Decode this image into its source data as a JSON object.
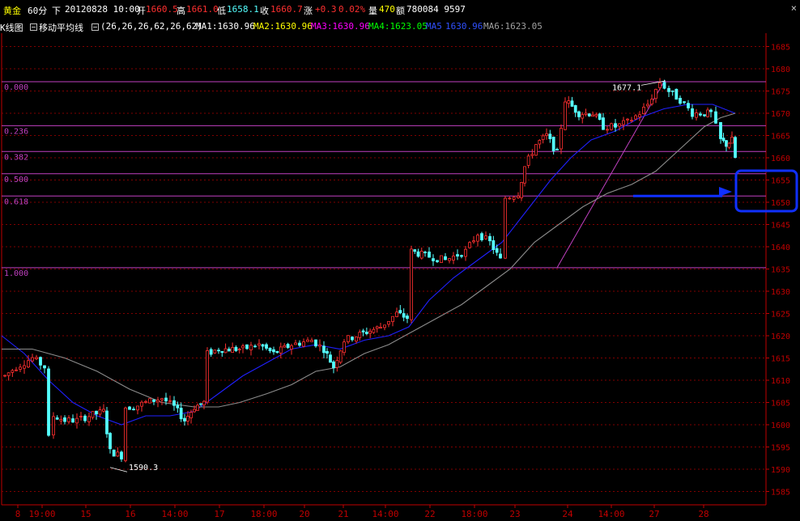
{
  "header": {
    "symbol": "黄金",
    "period": "60分",
    "direction": "下",
    "datetime": "20120828 10:00",
    "open_label": "开",
    "open": "1660.5",
    "high_label": "高",
    "high": "1661.0",
    "low_label": "低",
    "low": "1658.1",
    "close_label": "收",
    "close": "1660.7",
    "change_label": "涨",
    "change": "+0.3",
    "change_pct": "0.02%",
    "volume_label": "量",
    "volume": "470",
    "amount_label": "额",
    "amount": "780084 9597",
    "close_icon": "close-x-icon"
  },
  "indicator": {
    "kline_label": "K线图",
    "ma_label": "移动平均线",
    "params": "(26,26,26,62,26,62)",
    "ma": [
      {
        "label": "MA1:1630.96",
        "color": "#ffffff"
      },
      {
        "label": "MA2:1630.96",
        "color": "#ffff00"
      },
      {
        "label": "MA3:1630.96",
        "color": "#ff00ff"
      },
      {
        "label": "MA4:1623.05",
        "color": "#00ff00"
      },
      {
        "label": "MA5",
        "color": "#3050ff"
      },
      {
        "label": "1630.96",
        "color": "#3050ff"
      },
      {
        "label": "MA6:1623.05",
        "color": "#a0a0a0"
      }
    ]
  },
  "colors": {
    "up": "#ff3030",
    "down": "#54ffff",
    "fib": "#c040c0",
    "grid": "#800000",
    "axis": "#c00000",
    "ma_blue": "#2020ff",
    "ma_grey": "#8c8c8c",
    "highlight": "#1030ff"
  },
  "fib_labels": [
    "0.000",
    "0.236",
    "0.382",
    "0.500",
    "0.618",
    "1.000"
  ],
  "annotations": {
    "high": "1677.1",
    "low": "1590.3"
  },
  "chart_data": {
    "type": "candlestick",
    "yticks": [
      "1685",
      "1680",
      "1675",
      "1670",
      "1665",
      "1660",
      "1655",
      "1650",
      "1645",
      "1640",
      "1635",
      "1630",
      "1625",
      "1620",
      "1615",
      "1610",
      "1605",
      "1600",
      "1595",
      "1590",
      "1585"
    ],
    "ylim": [
      1582,
      1688
    ],
    "xticks": [
      "19:00",
      "8",
      "15",
      "16",
      "14:00",
      "17",
      "18:00",
      "20",
      "21",
      "14:00",
      "22",
      "18:00",
      "23",
      "24",
      "14:00",
      "27",
      "28"
    ],
    "fib_levels": [
      {
        "ratio": "0.000",
        "value": 1677.1
      },
      {
        "ratio": "0.236",
        "value": 1667.2
      },
      {
        "ratio": "0.382",
        "value": 1661.4
      },
      {
        "ratio": "0.500",
        "value": 1656.4
      },
      {
        "ratio": "0.618",
        "value": 1651.4
      },
      {
        "ratio": "1.000",
        "value": 1635.3
      }
    ],
    "high": 1677.1,
    "low": 1590.3,
    "last_close": 1660.7
  }
}
